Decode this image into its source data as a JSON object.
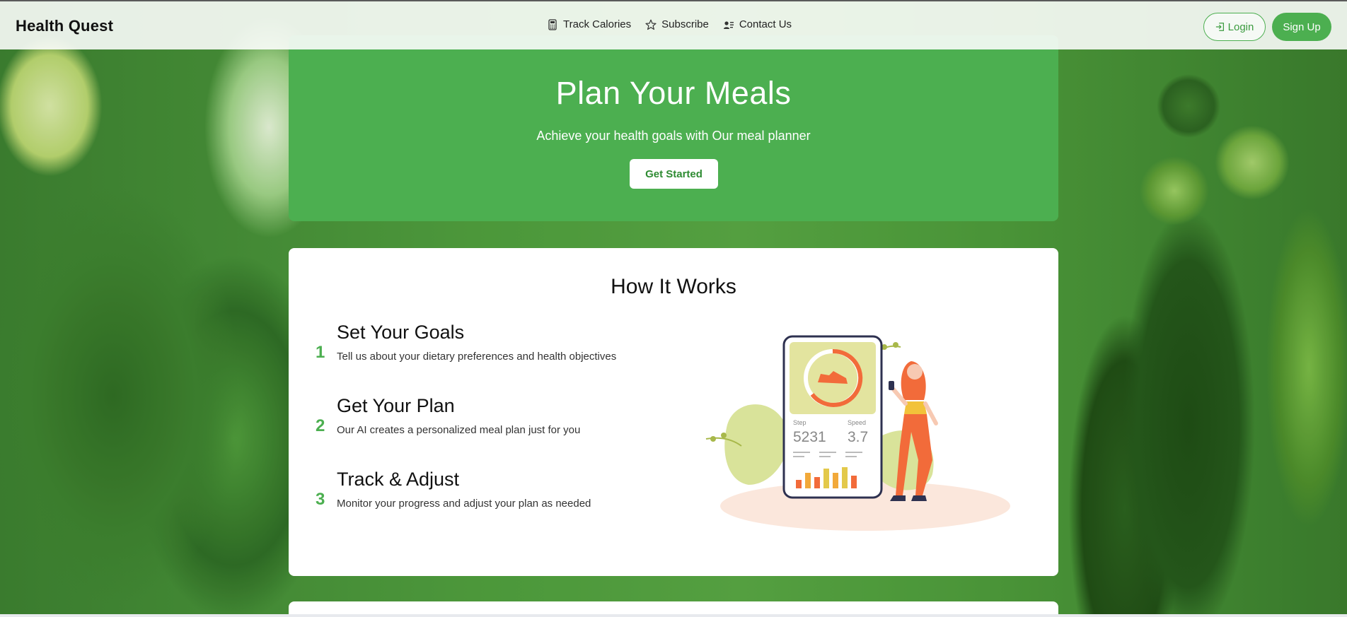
{
  "header": {
    "brand": "Health Quest",
    "nav": [
      {
        "label": "Track Calories",
        "icon": "calculator-icon"
      },
      {
        "label": "Subscribe",
        "icon": "star-icon"
      },
      {
        "label": "Contact Us",
        "icon": "contact-card-icon"
      }
    ],
    "login_label": "Login",
    "signup_label": "Sign Up"
  },
  "hero": {
    "title": "Plan Your Meals",
    "subtitle": "Achieve your health goals with Our meal planner",
    "cta_label": "Get Started"
  },
  "how": {
    "title": "How It Works",
    "steps": [
      {
        "num": "1",
        "title": "Set Your Goals",
        "desc": "Tell us about your dietary preferences and health objectives"
      },
      {
        "num": "2",
        "title": "Get Your Plan",
        "desc": "Our AI creates a personalized meal plan just for you"
      },
      {
        "num": "3",
        "title": "Track & Adjust",
        "desc": "Monitor your progress and adjust your plan as needed"
      }
    ],
    "illustration": {
      "step_label": "Step",
      "step_value": "5231",
      "speed_label": "Speed",
      "speed_value": "3.7"
    }
  },
  "colors": {
    "accent": "#4caf50",
    "accent_dark": "#2e8b32",
    "nav_bg": "#ffffff"
  }
}
